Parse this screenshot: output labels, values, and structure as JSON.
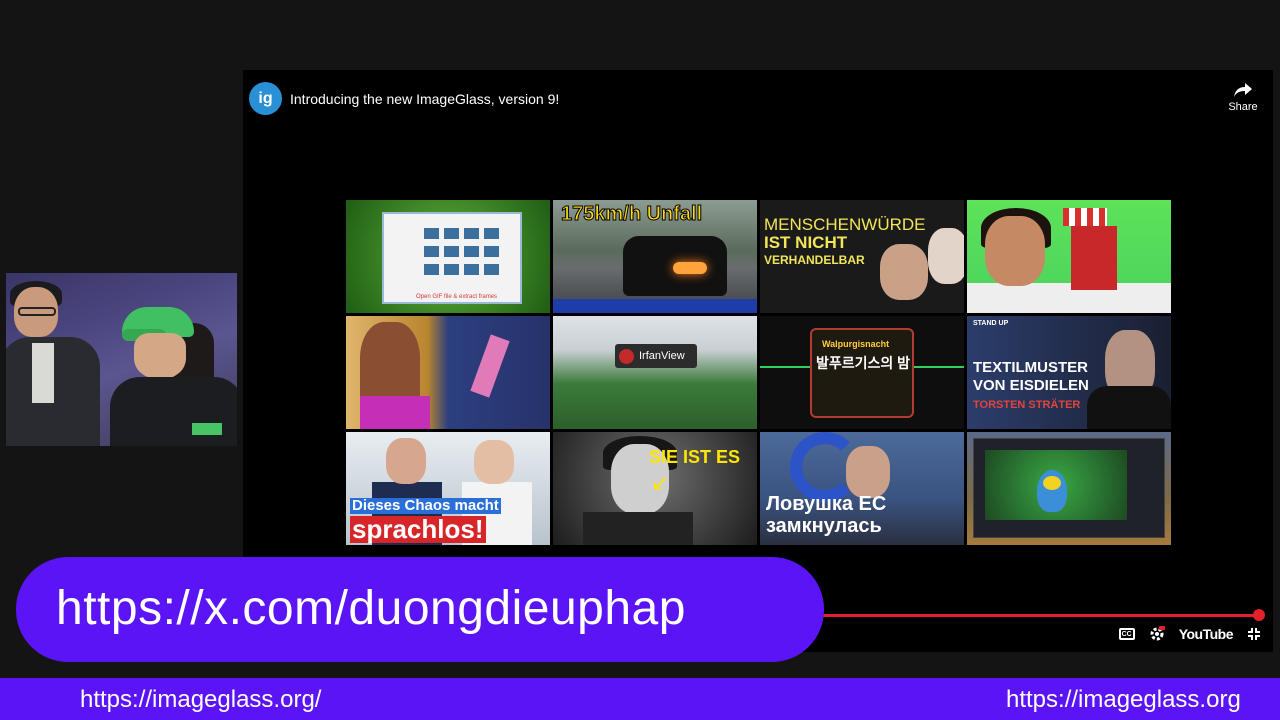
{
  "player": {
    "logo_text": "ig",
    "title": "Introducing the new ImageGlass, version 9!",
    "share_label": "Share",
    "brand": "YouTube",
    "accent_color": "#e3212b"
  },
  "thumbnails": [
    {
      "caption": "Open GIF file & extract frames"
    },
    {
      "caption": "175km/h Unfall"
    },
    {
      "caption_line1": "MENSCHENWÜRDE",
      "caption_line2": "IST NICHT",
      "caption_line3": "VERHANDELBAR"
    },
    {
      "caption": ""
    },
    {
      "caption": ""
    },
    {
      "caption": "IrfanView"
    },
    {
      "caption_line1": "Walpurgisnacht",
      "caption_line2": "발푸르기스의 밤"
    },
    {
      "caption_line1": "TEXTILMUSTER",
      "caption_line2": "VON EISDIELEN",
      "caption_line3": "TORSTEN STRÄTER",
      "tag": "STAND UP"
    },
    {
      "caption_line1": "Dieses Chaos macht",
      "caption_line2": "sprachlos!"
    },
    {
      "caption": "SIE IST ES"
    },
    {
      "caption_line1": "Ловушка ЕС",
      "caption_line2": "замкнулась"
    },
    {
      "caption": ""
    }
  ],
  "banner": {
    "url": "https://x.com/duongdieuphap",
    "color": "#5a14f5"
  },
  "footer": {
    "left_url": "https://imageglass.org/",
    "right_url": "https://imageglass.org"
  }
}
